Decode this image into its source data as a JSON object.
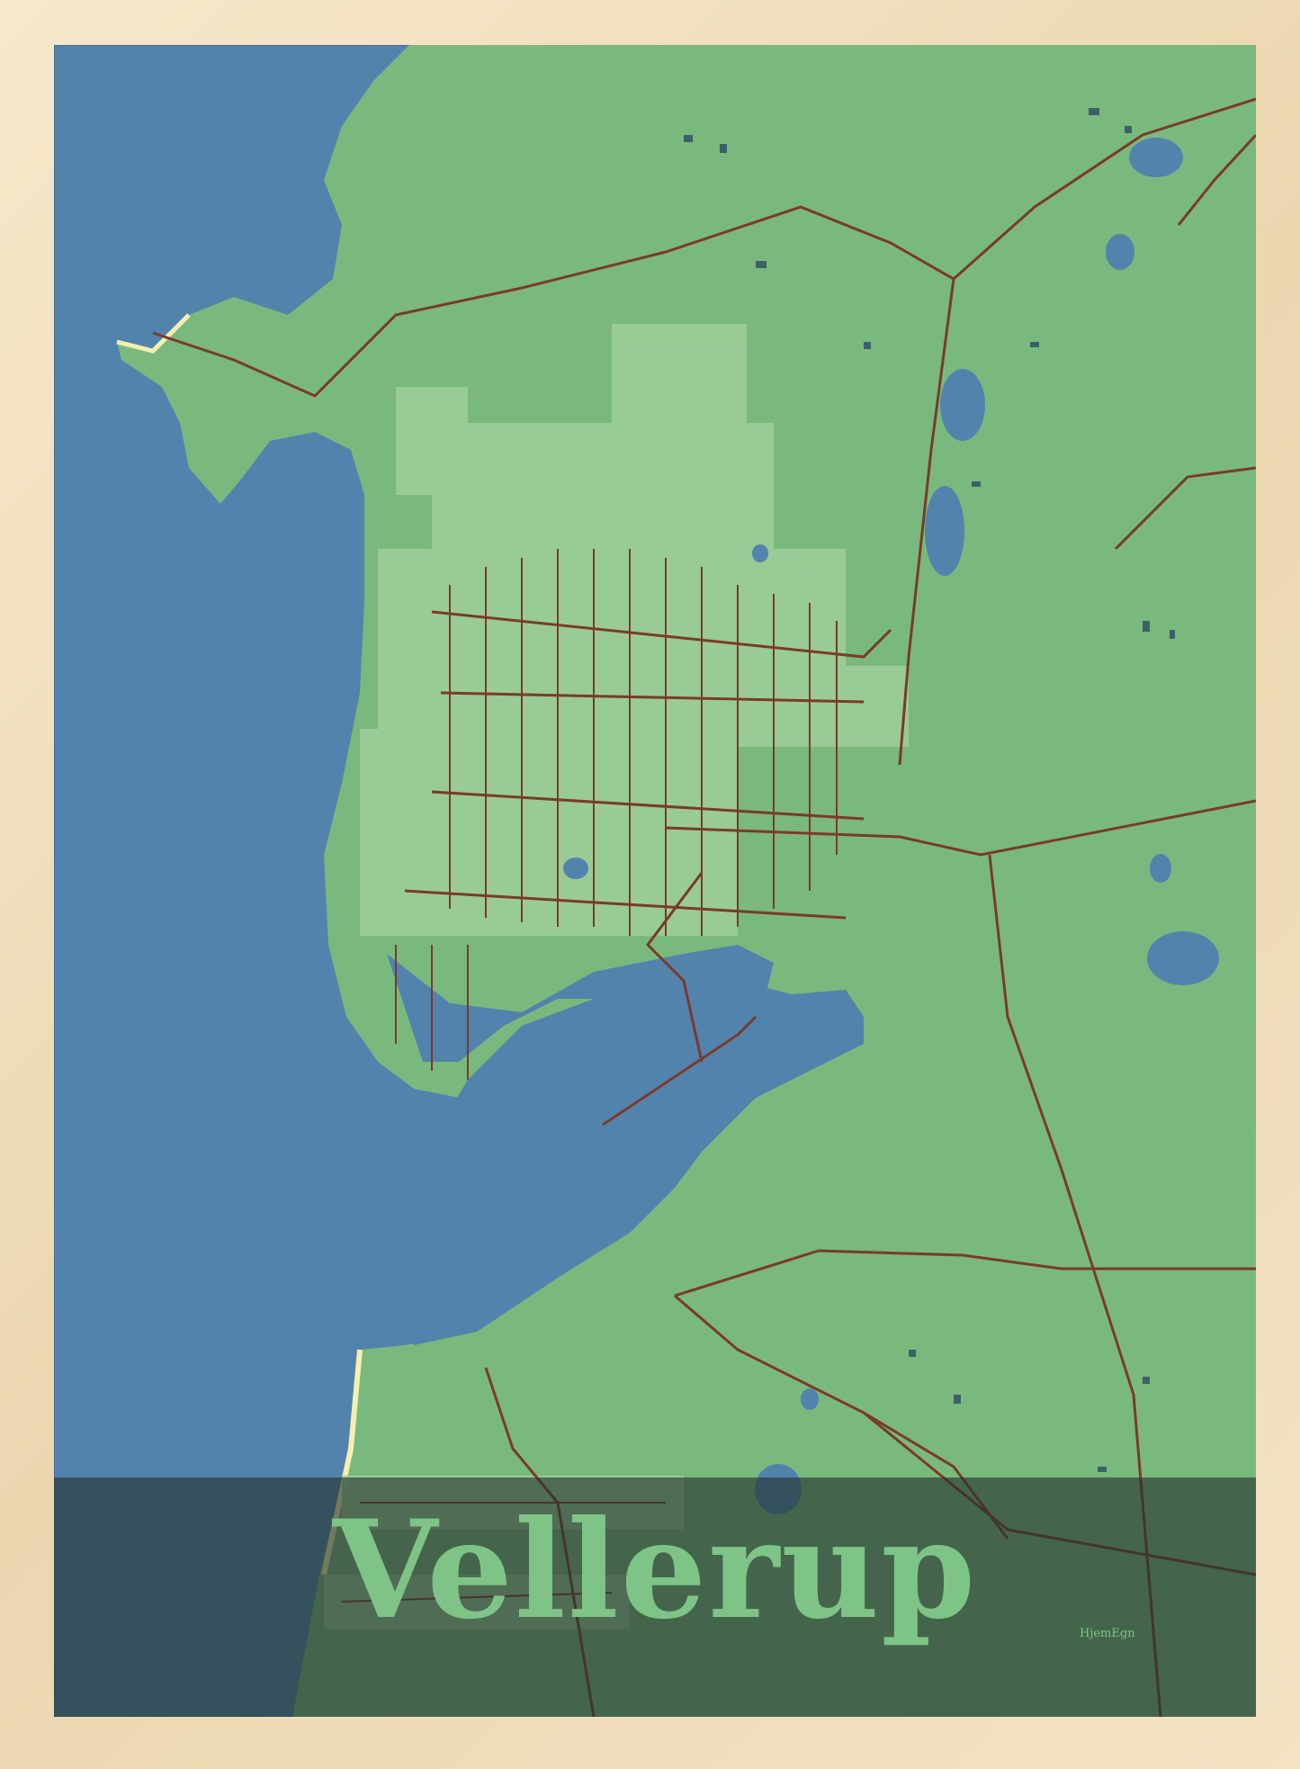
{
  "poster": {
    "place_name": "Vellerup",
    "brand": "HjemEgn"
  },
  "colors": {
    "water": "#5283ad",
    "land": "#7ab97d",
    "land_light": "#9ccd98",
    "roads": "#7a3a2a",
    "buildings": "#3d6068",
    "beach": "#f5f0b0",
    "frame": "#f2e3c6",
    "band": "#2f3f36",
    "title": "#7fc487"
  }
}
